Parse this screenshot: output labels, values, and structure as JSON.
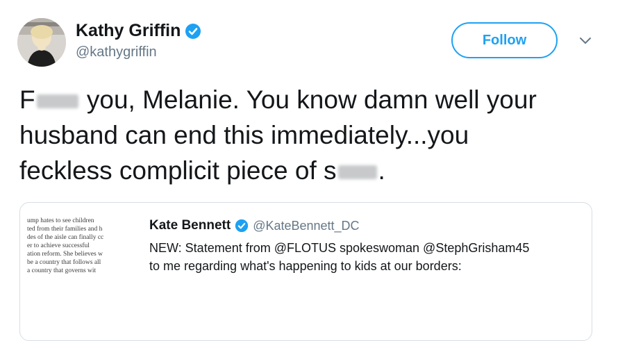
{
  "author": {
    "name": "Kathy Griffin",
    "handle": "@kathygriffin"
  },
  "follow_button": {
    "label": "Follow"
  },
  "tweet": {
    "line1_start": "F",
    "line1_end": " you, Melanie. You know damn well your",
    "line2": "husband can end this immediately...you",
    "line3_start": "feckless complicit piece of s",
    "line3_end": "."
  },
  "quoted_tweet": {
    "name": "Kate Bennett",
    "handle": "@KateBennett_DC",
    "text_line1": "NEW: Statement from @FLOTUS spokeswoman @StephGrisham45",
    "text_line2": "to me regarding what's happening to kids at our borders:",
    "image_text": [
      "ump hates to see children",
      "ted from their families and h",
      "des of the aisle can finally cc",
      "er to achieve successful",
      "ation reform.  She believes w",
      "be a country that follows all",
      "a country that governs wit"
    ]
  },
  "colors": {
    "accent": "#1da1f2",
    "text": "#14171a",
    "secondary_text": "#657786",
    "border": "#d7dde3"
  },
  "icons": {
    "verified": "verified-badge-icon",
    "more": "chevron-down-icon"
  }
}
